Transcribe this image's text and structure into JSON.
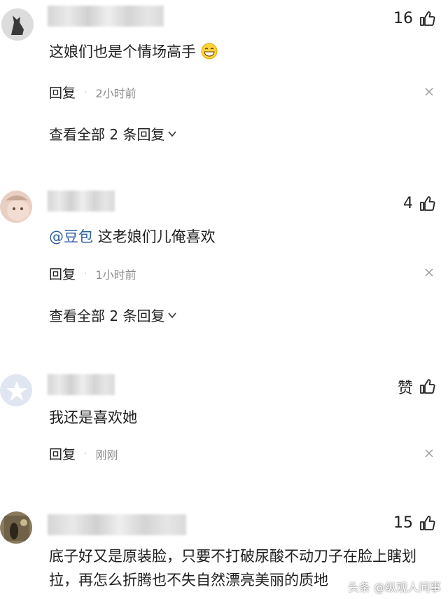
{
  "comments": [
    {
      "content": "这娘们也是个情场高手",
      "emoji": "grinning-emoji",
      "likes": "16",
      "reply_label": "回复",
      "time": "2小时前",
      "view_replies": "查看全部 2 条回复"
    },
    {
      "mention": "@豆包",
      "content": " 这老娘们儿俺喜欢",
      "likes": "4",
      "reply_label": "回复",
      "time": "1小时前",
      "view_replies": "查看全部 2 条回复"
    },
    {
      "content": "我还是喜欢她",
      "likes": "赞",
      "reply_label": "回复",
      "time": "刚刚"
    },
    {
      "content": "底子好又是原装脸，只要不打破尿酸不动刀子在脸上瞎划拉，再怎么折腾也不失自然漂亮美丽的质地",
      "likes": "15"
    }
  ],
  "watermark": "头条 @纵观人间事",
  "icons": {
    "like": "thumbs-up-icon",
    "close": "close-icon",
    "chevron": "chevron-down-icon"
  }
}
